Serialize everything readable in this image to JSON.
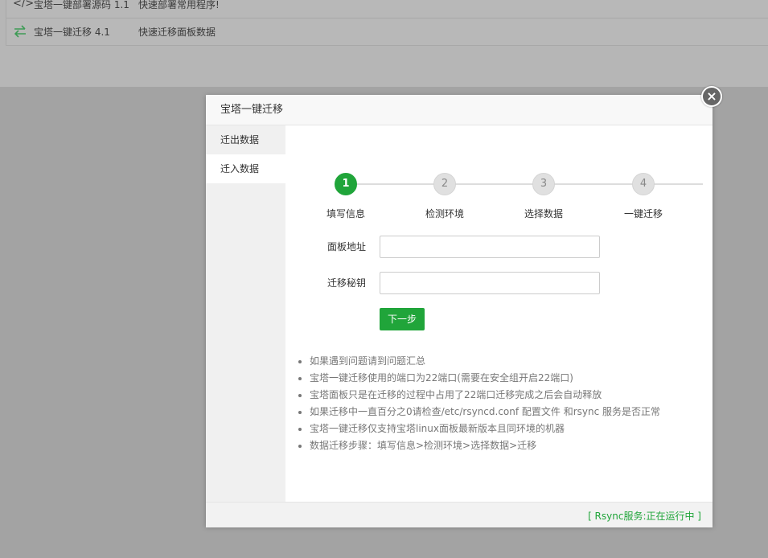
{
  "background": {
    "rows": [
      {
        "icon": "code-icon",
        "name": "宝塔一键部署源码 1.1",
        "desc": "快速部署常用程序!"
      },
      {
        "icon": "transfer-icon",
        "name": "宝塔一键迁移 4.1",
        "desc": "快速迁移面板数据"
      }
    ]
  },
  "modal": {
    "title": "宝塔一键迁移",
    "close": "×",
    "sidebar": [
      "迁出数据",
      "迁入数据"
    ],
    "steps": [
      {
        "num": "1",
        "label": "填写信息"
      },
      {
        "num": "2",
        "label": "检测环境"
      },
      {
        "num": "3",
        "label": "选择数据"
      },
      {
        "num": "4",
        "label": "一键迁移"
      }
    ],
    "form": {
      "panel_address_label": "面板地址",
      "panel_address_value": "",
      "migrate_key_label": "迁移秘钥",
      "migrate_key_value": "",
      "next_label": "下一步"
    },
    "tips": [
      "如果遇到问题请到问题汇总",
      "宝塔一键迁移使用的端口为22端口(需要在安全组开启22端口)",
      "宝塔面板只是在迁移的过程中占用了22端口迁移完成之后会自动释放",
      "如果迁移中一直百分之0请检查/etc/rsyncd.conf 配置文件 和rsync 服务是否正常",
      "宝塔一键迁移仅支持宝塔linux面板最新版本且同环境的机器",
      "数据迁移步骤：填写信息>检测环境>选择数据>迁移"
    ],
    "status": "[ Rsync服务:正在运行中 ]"
  },
  "colors": {
    "accent": "#20a53a"
  }
}
